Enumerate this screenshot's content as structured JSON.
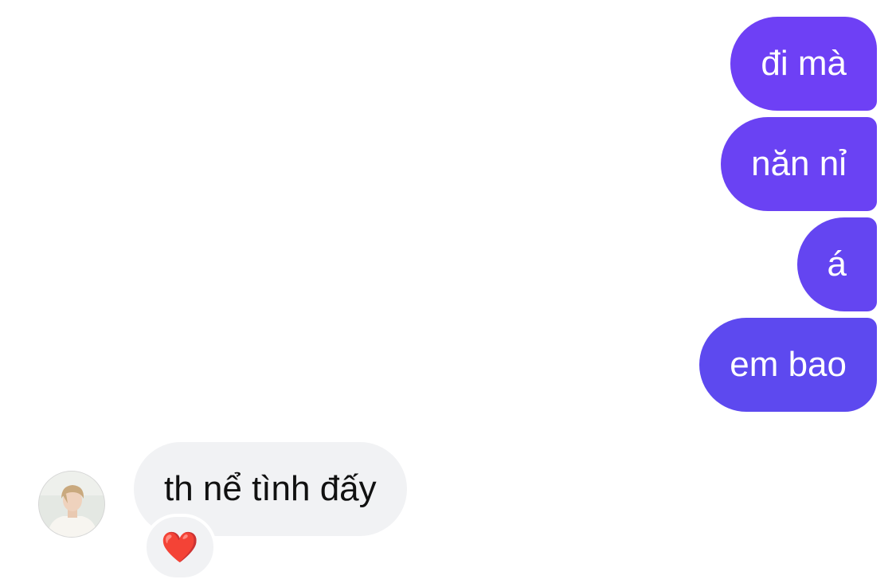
{
  "thread": {
    "outgoing_messages": [
      {
        "text": "đi mà"
      },
      {
        "text": "năn nỉ"
      },
      {
        "text": "á"
      },
      {
        "text": "em bao"
      }
    ],
    "incoming_message": {
      "text": "th nể tình đấy",
      "reaction": "❤️"
    }
  },
  "colors": {
    "outgoing_bubble_top": "#6f3ff5",
    "outgoing_bubble_bottom": "#5a4bee",
    "incoming_bubble": "#f1f2f4",
    "reaction_heart": "#e3192e"
  }
}
